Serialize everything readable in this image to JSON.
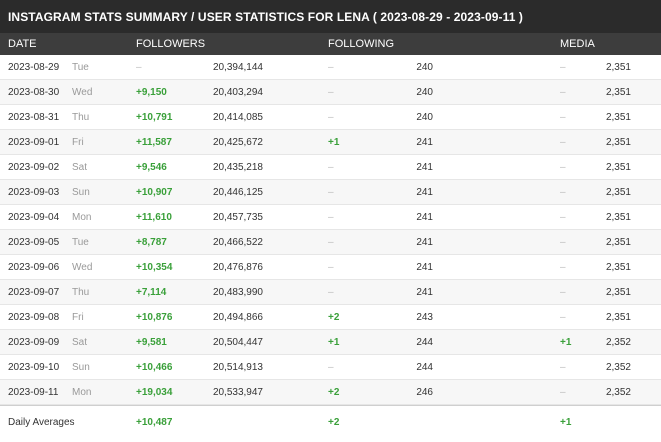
{
  "title": "INSTAGRAM STATS SUMMARY / USER STATISTICS FOR LENA ( 2023-08-29 - 2023-09-11 )",
  "columns": {
    "date": "DATE",
    "followers": "FOLLOWERS",
    "following": "FOLLOWING",
    "media": "MEDIA"
  },
  "rows": [
    {
      "date": "2023-08-29",
      "day": "Tue",
      "followers_delta": "–",
      "followers": "20,394,144",
      "following_delta": "–",
      "following": "240",
      "media_delta": "–",
      "media": "2,351"
    },
    {
      "date": "2023-08-30",
      "day": "Wed",
      "followers_delta": "+9,150",
      "followers": "20,403,294",
      "following_delta": "–",
      "following": "240",
      "media_delta": "–",
      "media": "2,351"
    },
    {
      "date": "2023-08-31",
      "day": "Thu",
      "followers_delta": "+10,791",
      "followers": "20,414,085",
      "following_delta": "–",
      "following": "240",
      "media_delta": "–",
      "media": "2,351"
    },
    {
      "date": "2023-09-01",
      "day": "Fri",
      "followers_delta": "+11,587",
      "followers": "20,425,672",
      "following_delta": "+1",
      "following": "241",
      "media_delta": "–",
      "media": "2,351"
    },
    {
      "date": "2023-09-02",
      "day": "Sat",
      "followers_delta": "+9,546",
      "followers": "20,435,218",
      "following_delta": "–",
      "following": "241",
      "media_delta": "–",
      "media": "2,351"
    },
    {
      "date": "2023-09-03",
      "day": "Sun",
      "followers_delta": "+10,907",
      "followers": "20,446,125",
      "following_delta": "–",
      "following": "241",
      "media_delta": "–",
      "media": "2,351"
    },
    {
      "date": "2023-09-04",
      "day": "Mon",
      "followers_delta": "+11,610",
      "followers": "20,457,735",
      "following_delta": "–",
      "following": "241",
      "media_delta": "–",
      "media": "2,351"
    },
    {
      "date": "2023-09-05",
      "day": "Tue",
      "followers_delta": "+8,787",
      "followers": "20,466,522",
      "following_delta": "–",
      "following": "241",
      "media_delta": "–",
      "media": "2,351"
    },
    {
      "date": "2023-09-06",
      "day": "Wed",
      "followers_delta": "+10,354",
      "followers": "20,476,876",
      "following_delta": "–",
      "following": "241",
      "media_delta": "–",
      "media": "2,351"
    },
    {
      "date": "2023-09-07",
      "day": "Thu",
      "followers_delta": "+7,114",
      "followers": "20,483,990",
      "following_delta": "–",
      "following": "241",
      "media_delta": "–",
      "media": "2,351"
    },
    {
      "date": "2023-09-08",
      "day": "Fri",
      "followers_delta": "+10,876",
      "followers": "20,494,866",
      "following_delta": "+2",
      "following": "243",
      "media_delta": "–",
      "media": "2,351"
    },
    {
      "date": "2023-09-09",
      "day": "Sat",
      "followers_delta": "+9,581",
      "followers": "20,504,447",
      "following_delta": "+1",
      "following": "244",
      "media_delta": "+1",
      "media": "2,352"
    },
    {
      "date": "2023-09-10",
      "day": "Sun",
      "followers_delta": "+10,466",
      "followers": "20,514,913",
      "following_delta": "–",
      "following": "244",
      "media_delta": "–",
      "media": "2,352"
    },
    {
      "date": "2023-09-11",
      "day": "Mon",
      "followers_delta": "+19,034",
      "followers": "20,533,947",
      "following_delta": "+2",
      "following": "246",
      "media_delta": "–",
      "media": "2,352"
    }
  ],
  "averages": {
    "label": "Daily Averages",
    "followers": "+10,487",
    "following": "+2",
    "media": "+1"
  },
  "colors": {
    "title_bg": "#2b2b2b",
    "header_bg": "#3d3d3d",
    "positive": "#3aa03a",
    "dash": "#bdbdbd"
  }
}
